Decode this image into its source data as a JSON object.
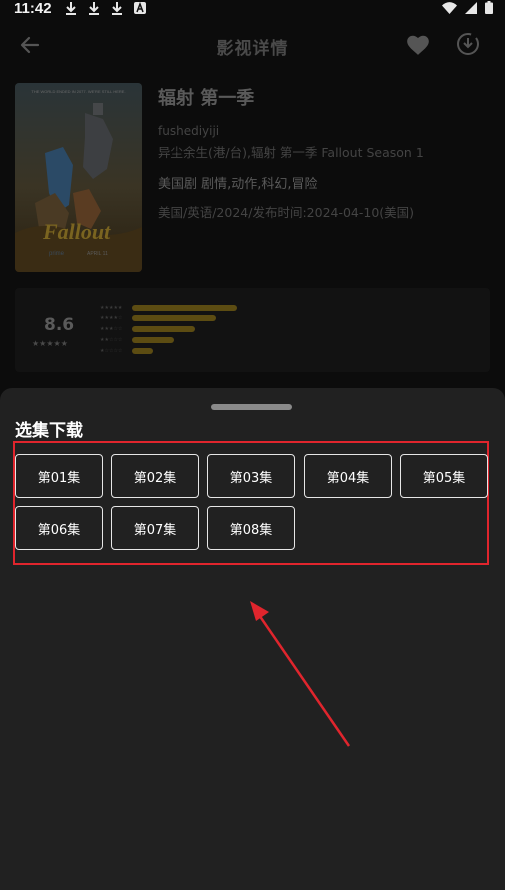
{
  "status_bar": {
    "time": "11:42"
  },
  "header": {
    "title": "影视详情"
  },
  "movie": {
    "title": "辐射 第一季",
    "subtitle": "fushediyiji",
    "alias": "异尘余生(港/台),辐射 第一季 Fallout Season 1",
    "genre": "美国剧 剧情,动作,科幻,冒险",
    "meta": "美国/英语/2024/发布时间:2024-04-10(美国)",
    "poster": {
      "logo": "Fallout",
      "tagline": "THE WORLD ENDED IN 2077. WE'RE STILL HERE.",
      "date": "APRIL 11",
      "brand": "prime"
    }
  },
  "rating": {
    "score": "8.6",
    "stars_display": "★★★★★",
    "distribution": [
      {
        "stars": "★★★★★",
        "value": 0.5
      },
      {
        "stars": "★★★★☆",
        "value": 0.4
      },
      {
        "stars": "★★★☆☆",
        "value": 0.3
      },
      {
        "stars": "★★☆☆☆",
        "value": 0.2
      },
      {
        "stars": "★☆☆☆☆",
        "value": 0.1
      }
    ]
  },
  "sheet": {
    "title": "选集下载",
    "episodes": [
      "第01集",
      "第02集",
      "第03集",
      "第04集",
      "第05集",
      "第06集",
      "第07集",
      "第08集"
    ]
  },
  "colors": {
    "highlight_border": "#e0252d",
    "accent_bar": "#5c4c12",
    "sheet_bg": "#212121"
  }
}
